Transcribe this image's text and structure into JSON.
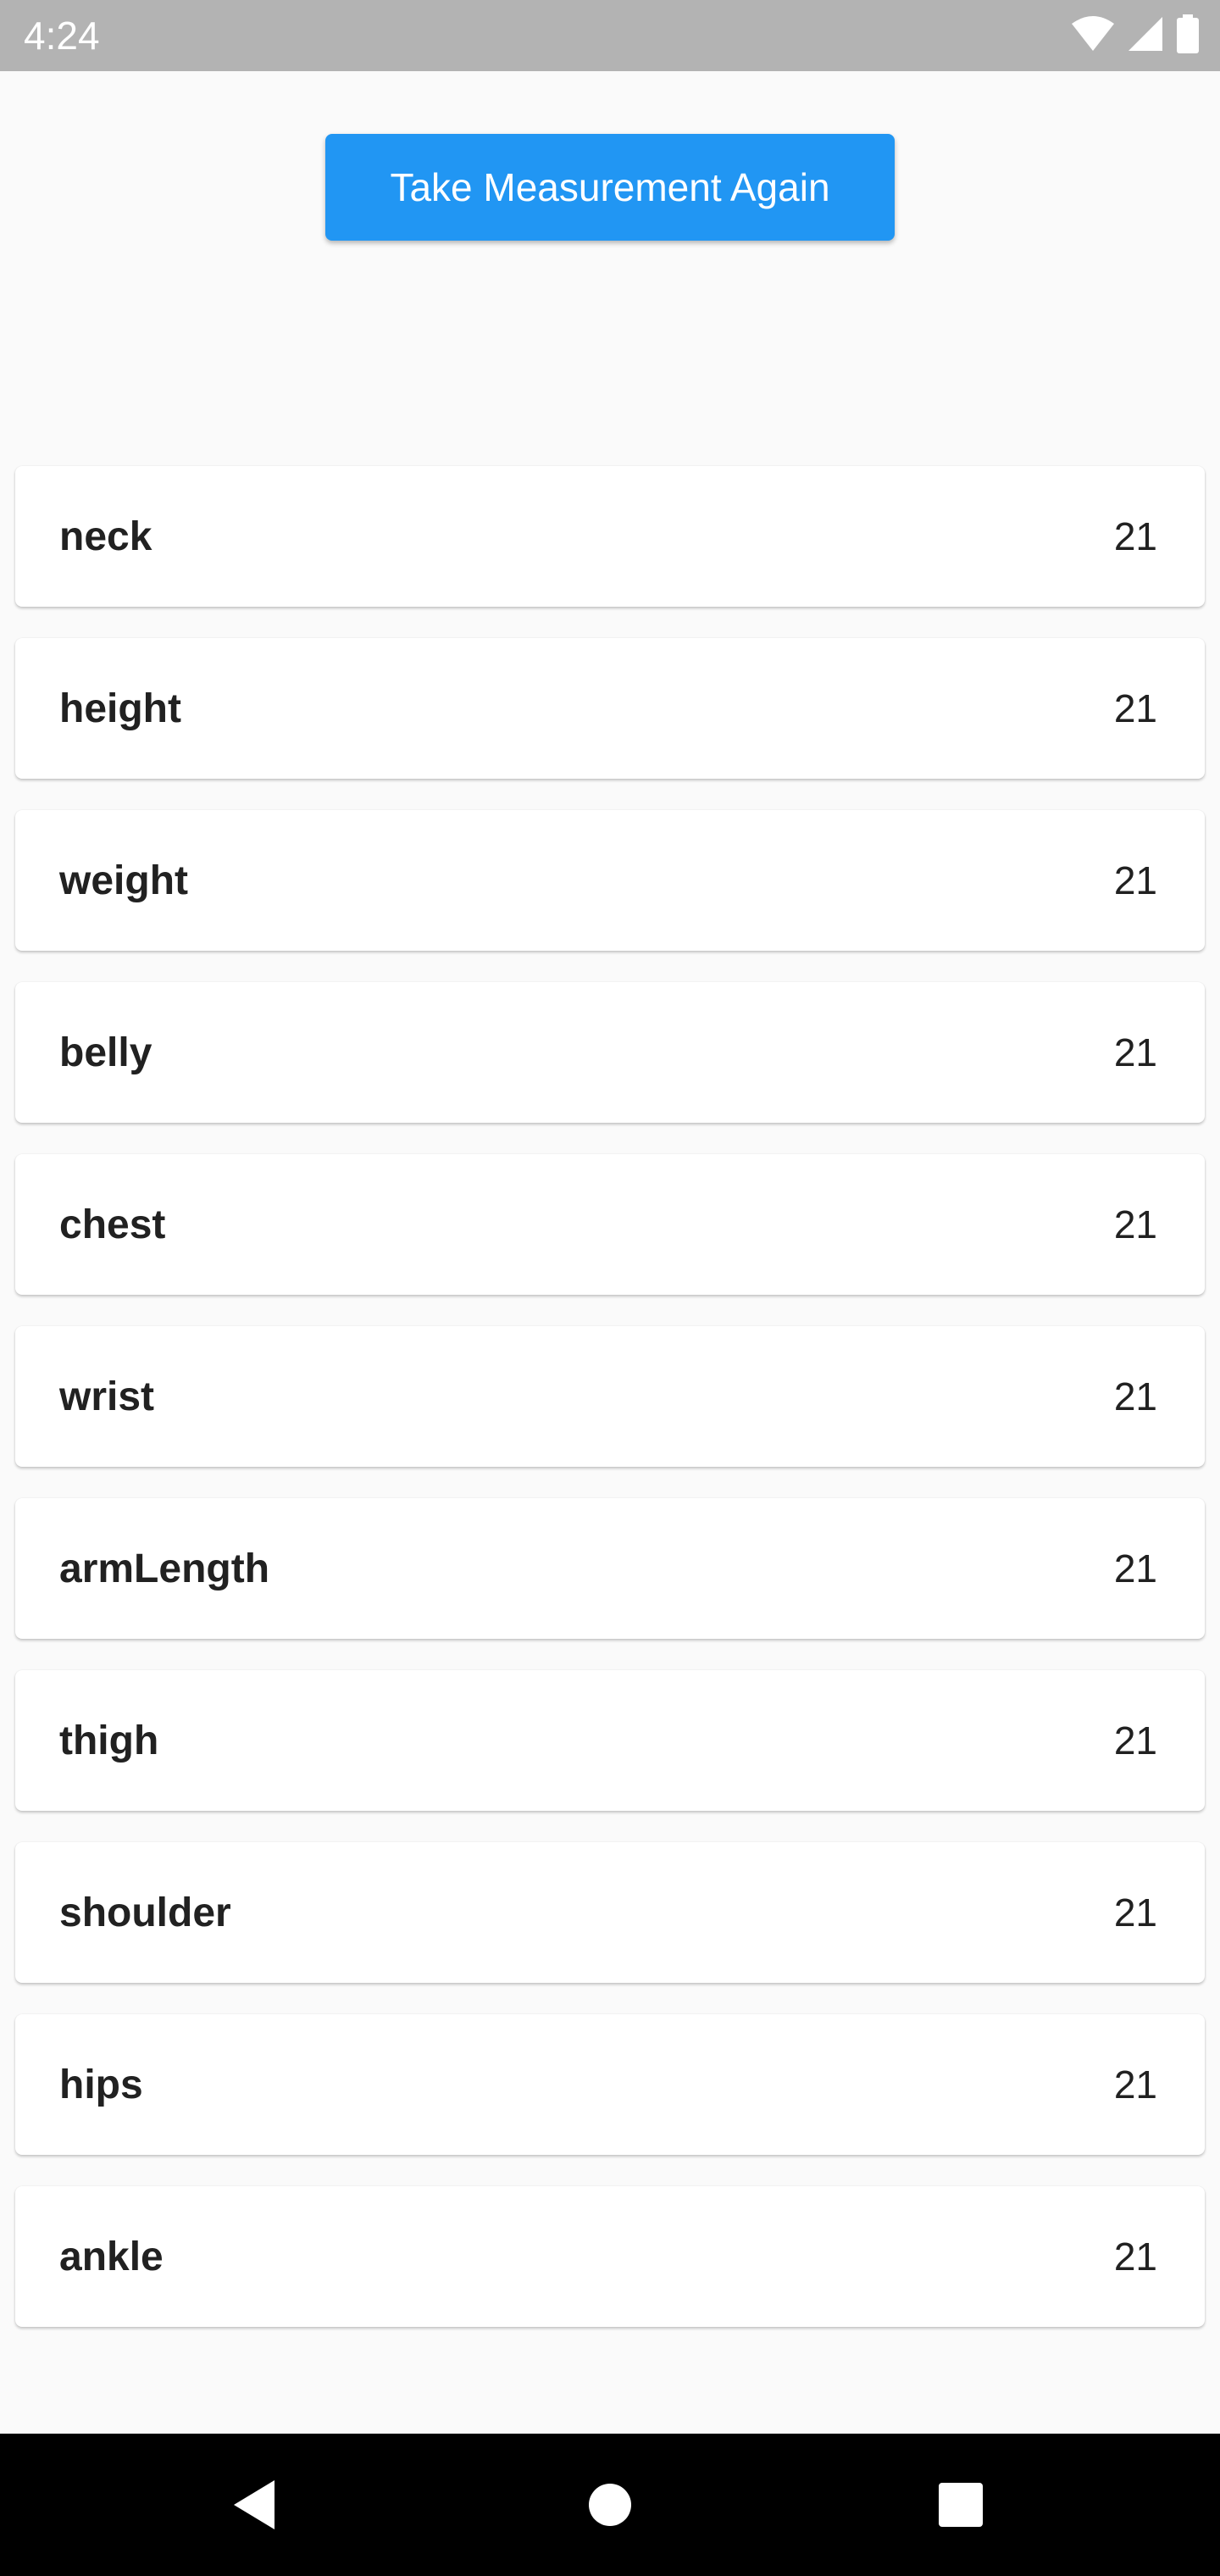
{
  "status_bar": {
    "time": "4:24",
    "icons": [
      "wifi-icon",
      "cell-signal-icon",
      "battery-icon"
    ]
  },
  "main": {
    "button_label": "Take Measurement Again",
    "accent_color": "#2196f3"
  },
  "measurements": [
    {
      "label": "neck",
      "value": "21"
    },
    {
      "label": "height",
      "value": "21"
    },
    {
      "label": "weight",
      "value": "21"
    },
    {
      "label": "belly",
      "value": "21"
    },
    {
      "label": "chest",
      "value": "21"
    },
    {
      "label": "wrist",
      "value": "21"
    },
    {
      "label": "armLength",
      "value": "21"
    },
    {
      "label": "thigh",
      "value": "21"
    },
    {
      "label": "shoulder",
      "value": "21"
    },
    {
      "label": "hips",
      "value": "21"
    },
    {
      "label": "ankle",
      "value": "21"
    }
  ],
  "nav_bar": {
    "buttons": [
      "back-icon",
      "home-icon",
      "recents-icon"
    ]
  }
}
